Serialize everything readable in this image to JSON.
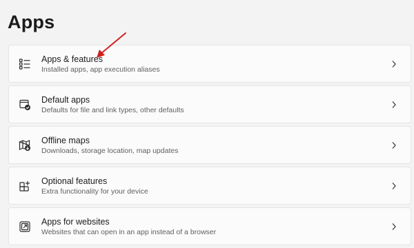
{
  "page": {
    "title": "Apps"
  },
  "items": [
    {
      "title": "Apps & features",
      "subtitle": "Installed apps, app execution aliases",
      "icon": "apps-list-icon"
    },
    {
      "title": "Default apps",
      "subtitle": "Defaults for file and link types, other defaults",
      "icon": "default-apps-icon"
    },
    {
      "title": "Offline maps",
      "subtitle": "Downloads, storage location, map updates",
      "icon": "offline-maps-icon"
    },
    {
      "title": "Optional features",
      "subtitle": "Extra functionality for your device",
      "icon": "optional-features-icon"
    },
    {
      "title": "Apps for websites",
      "subtitle": "Websites that can open in an app instead of a browser",
      "icon": "apps-for-websites-icon"
    }
  ],
  "colors": {
    "background": "#f3f3f3",
    "card": "#fbfbfb",
    "annotation_arrow": "#d21f1f"
  }
}
